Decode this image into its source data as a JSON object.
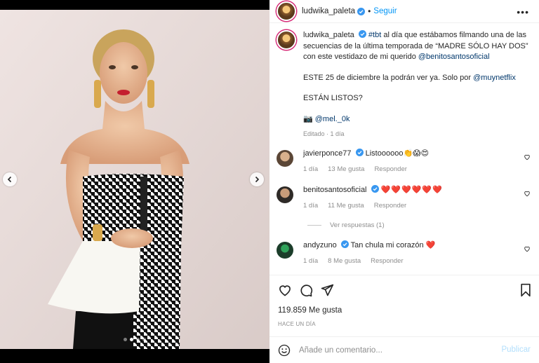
{
  "post": {
    "username": "ludwika_paleta",
    "follow_label": "Seguir",
    "separator": "•",
    "more_label": "•••"
  },
  "caption": {
    "username": "ludwika_paleta",
    "hashtag": "#tbt",
    "text1": " al día que estábamos filmando una de las secuencias de la última temporada de “MADRE SÓLO HAY DOS” con este vestidazo de mi querido ",
    "mention1": "@benitosantosoficial",
    "line2_text": "ESTE 25 de diciembre la podrán ver ya. Solo por ",
    "mention2": "@muynetflix",
    "line3": "ESTÁN LISTOS?",
    "camera_emoji": "📷",
    "mention3": "@mel._0k",
    "meta": "Editado · 1 día"
  },
  "comments": [
    {
      "username": "javierponce77",
      "text": "Listoooooo👏😱😍",
      "time": "1 día",
      "likes": "13 Me gusta",
      "reply": "Responder"
    },
    {
      "username": "benitosantosoficial",
      "text": "❤️❤️❤️❤️❤️❤️",
      "time": "1 día",
      "likes": "11 Me gusta",
      "reply": "Responder"
    },
    {
      "username": "andyzuno",
      "text": "Tan chula mi corazón ❤️",
      "time": "1 día",
      "likes": "8 Me gusta",
      "reply": "Responder"
    }
  ],
  "view_replies": "Ver respuestas (1)",
  "likes_label": "119.859 Me gusta",
  "time_ago": "HACE UN DÍA",
  "comment_box": {
    "placeholder": "Añade un comentario...",
    "post_label": "Publicar"
  },
  "carousel": {
    "total_slides": 4,
    "active_index": 1
  },
  "colors": {
    "follow": "#0095f6",
    "link": "#00376b",
    "verified": "#3897f0",
    "post_disabled": "#b2dffc",
    "heart_red": "#e0245e"
  },
  "icons": [
    "chevron-left-icon",
    "chevron-right-icon",
    "verified-icon",
    "more-icon",
    "heart-icon",
    "comment-icon",
    "share-icon",
    "bookmark-icon",
    "emoji-icon"
  ]
}
